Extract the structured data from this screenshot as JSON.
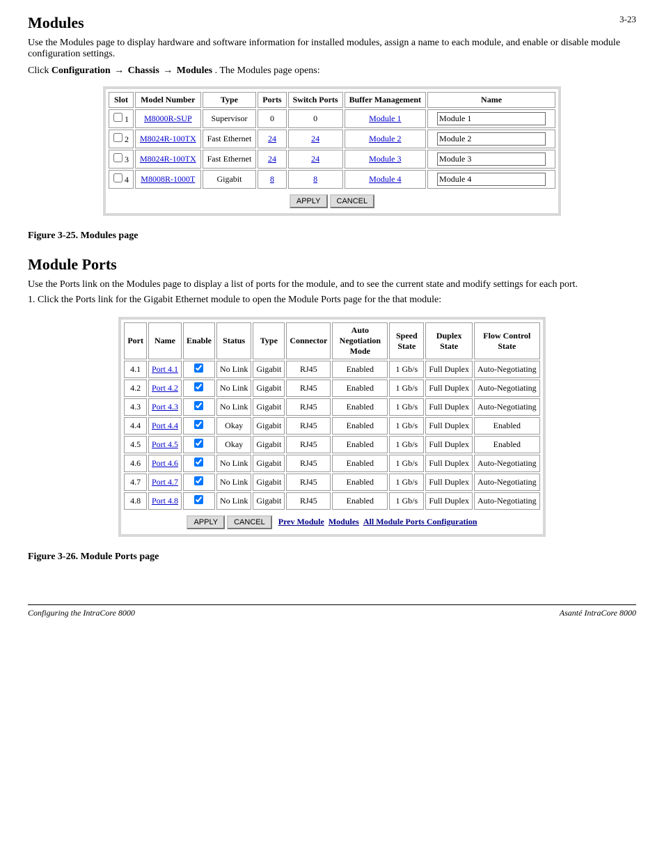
{
  "page_number": "3-23",
  "sections": {
    "modules": {
      "heading": "Modules",
      "intro_para": "Use the Modules page to display hardware and software information for installed modules, assign a name to each module, and enable or disable module configuration settings.",
      "path_lead": "Click",
      "path_parts": [
        "Configuration",
        "Chassis",
        "Modules"
      ],
      "path_tail": ". The Modules page opens:",
      "table": {
        "headers": [
          "Slot",
          "Model Number",
          "Type",
          "Ports",
          "Switch Ports",
          "Buffer Management",
          "Name"
        ],
        "rows": [
          {
            "slot": "1",
            "model": "M8000R-SUP",
            "type": "Supervisor",
            "ports": "0",
            "switch_ports": "0",
            "buffer": "Module 1",
            "name": "Module 1"
          },
          {
            "slot": "2",
            "model": "M8024R-100TX",
            "type": "Fast Ethernet",
            "ports": "24",
            "switch_ports": "24",
            "buffer": "Module 2",
            "name": "Module 2"
          },
          {
            "slot": "3",
            "model": "M8024R-100TX",
            "type": "Fast Ethernet",
            "ports": "24",
            "switch_ports": "24",
            "buffer": "Module 3",
            "name": "Module 3"
          },
          {
            "slot": "4",
            "model": "M8008R-1000T",
            "type": "Gigabit",
            "ports": "8",
            "switch_ports": "8",
            "buffer": "Module 4",
            "name": "Module 4"
          }
        ],
        "apply": "APPLY",
        "cancel": "CANCEL"
      },
      "fig_label": "Figure 3-25. Modules page"
    },
    "module_ports": {
      "heading": "Module Ports",
      "intro_para": "Use the Ports link on the Modules page to display a list of ports for the module, and to see the current state and modify settings for each port.",
      "step1": "Click the Ports link for the Gigabit Ethernet module to open the Module Ports page for the that module:",
      "table": {
        "headers": [
          "Port",
          "Name",
          "Enable",
          "Status",
          "Type",
          "Connector",
          "Auto Negotiation Mode",
          "Speed State",
          "Duplex State",
          "Flow Control State"
        ],
        "rows": [
          {
            "port": "4.1",
            "name": "Port 4.1",
            "status": "No Link",
            "type": "Gigabit",
            "connector": "RJ45",
            "auto": "Enabled",
            "speed": "1 Gb/s",
            "duplex": "Full Duplex",
            "flow": "Auto-Negotiating"
          },
          {
            "port": "4.2",
            "name": "Port 4.2",
            "status": "No Link",
            "type": "Gigabit",
            "connector": "RJ45",
            "auto": "Enabled",
            "speed": "1 Gb/s",
            "duplex": "Full Duplex",
            "flow": "Auto-Negotiating"
          },
          {
            "port": "4.3",
            "name": "Port 4.3",
            "status": "No Link",
            "type": "Gigabit",
            "connector": "RJ45",
            "auto": "Enabled",
            "speed": "1 Gb/s",
            "duplex": "Full Duplex",
            "flow": "Auto-Negotiating"
          },
          {
            "port": "4.4",
            "name": "Port 4.4",
            "status": "Okay",
            "type": "Gigabit",
            "connector": "RJ45",
            "auto": "Enabled",
            "speed": "1 Gb/s",
            "duplex": "Full Duplex",
            "flow": "Enabled"
          },
          {
            "port": "4.5",
            "name": "Port 4.5",
            "status": "Okay",
            "type": "Gigabit",
            "connector": "RJ45",
            "auto": "Enabled",
            "speed": "1 Gb/s",
            "duplex": "Full Duplex",
            "flow": "Enabled"
          },
          {
            "port": "4.6",
            "name": "Port 4.6",
            "status": "No Link",
            "type": "Gigabit",
            "connector": "RJ45",
            "auto": "Enabled",
            "speed": "1 Gb/s",
            "duplex": "Full Duplex",
            "flow": "Auto-Negotiating"
          },
          {
            "port": "4.7",
            "name": "Port 4.7",
            "status": "No Link",
            "type": "Gigabit",
            "connector": "RJ45",
            "auto": "Enabled",
            "speed": "1 Gb/s",
            "duplex": "Full Duplex",
            "flow": "Auto-Negotiating"
          },
          {
            "port": "4.8",
            "name": "Port 4.8",
            "status": "No Link",
            "type": "Gigabit",
            "connector": "RJ45",
            "auto": "Enabled",
            "speed": "1 Gb/s",
            "duplex": "Full Duplex",
            "flow": "Auto-Negotiating"
          }
        ],
        "apply": "APPLY",
        "cancel": "CANCEL",
        "links": [
          "Prev Module",
          "Modules",
          "All Module Ports Configuration"
        ]
      },
      "fig_label": "Figure 3-26. Module Ports page"
    }
  },
  "footer": {
    "left": "Configuring the IntraCore 8000",
    "right": "Asanté IntraCore 8000"
  }
}
